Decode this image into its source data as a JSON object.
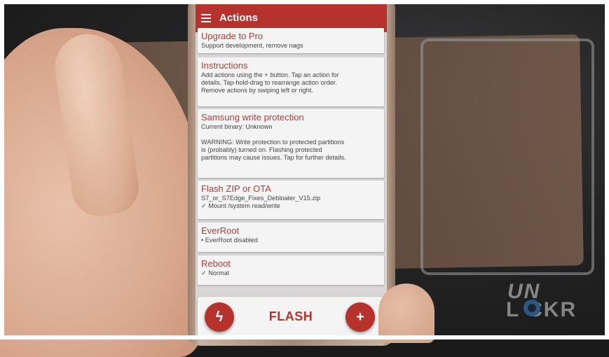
{
  "appbar": {
    "title": "Actions",
    "menu_icon": "hamburger-menu-icon"
  },
  "cards": [
    {
      "title": "Upgrade to Pro",
      "lines": [
        "Support development, remove nags"
      ]
    },
    {
      "title": "Instructions",
      "lines": [
        "Add actions using the + button. Tap an action for",
        "details. Tap-hold-drag to rearrange action order.",
        "Remove actions by swiping left or right."
      ]
    },
    {
      "title": "Samsung write protection",
      "lines": [
        "Current binary: Unknown",
        "",
        "WARNING: Write protection to protected partitions",
        "is (probably) turned on. Flashing protected",
        "partitions may cause issues. Tap for further details."
      ]
    },
    {
      "title": "Flash ZIP or OTA",
      "lines": [
        "S7_or_S7Edge_Fixes_Debloater_V15.zip",
        "✓ Mount /system read/write"
      ]
    },
    {
      "title": "EverRoot",
      "lines": [
        "• EverRoot disabled"
      ]
    },
    {
      "title": "Reboot",
      "lines": [
        "✓ Normal"
      ]
    }
  ],
  "bottom": {
    "flash_label": "FLASH",
    "left_icon": "lightning-bolt-icon",
    "left_glyph": "ϟ",
    "right_icon": "plus-icon",
    "right_glyph": "+"
  },
  "watermark": {
    "line1": "UN",
    "line2": "L  CKR"
  },
  "colors": {
    "accent": "#b5322d",
    "card_title": "#b23a36"
  }
}
